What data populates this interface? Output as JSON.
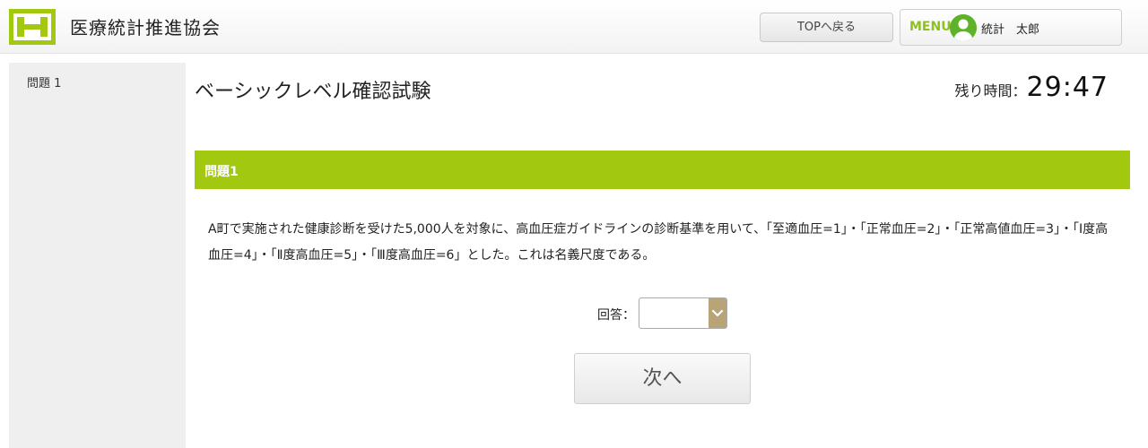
{
  "header": {
    "org_name": "医療統計推進協会",
    "top_button_label": "TOPへ戻る",
    "menu_label": "MENU",
    "user_name": "統計　太郎",
    "brand_color": "#a3c810",
    "logo_icon": "logo-icon",
    "avatar_icon": "user-avatar-icon"
  },
  "sidebar": {
    "items": [
      {
        "label": "問題 1"
      }
    ]
  },
  "main": {
    "exam_title": "ベーシックレベル確認試験",
    "timer_label": "残り時間：",
    "timer_value": "29:47",
    "question_header": "問題1",
    "question_text": "A町で実施された健康診断を受けた5,000人を対象に、高血圧症ガイドラインの診断基準を用いて、「至適血圧=1」・「正常血圧=2」・「正常高値血圧=3」・「Ⅰ度高血圧=4」・「Ⅱ度高血圧=5」・「Ⅲ度高血圧=6」とした。これは名義尺度である。",
    "answer_label": "回答：",
    "answer_value": "",
    "next_button_label": "次へ",
    "select_arrow_icon": "chevron-down-icon"
  }
}
